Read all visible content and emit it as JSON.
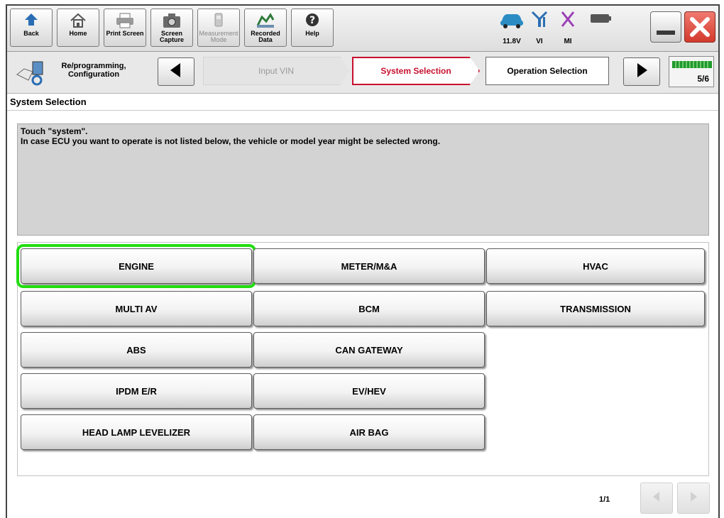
{
  "toolbar": {
    "back_label": "Back",
    "home_label": "Home",
    "print_screen_label": "Print Screen",
    "screen_capture_label": "Screen Capture",
    "measurement_mode_label": "Measurement Mode",
    "recorded_data_label": "Recorded Data",
    "help_label": "Help",
    "battery_voltage": "11.8V",
    "vi_label": "VI",
    "mi_label": "MI"
  },
  "navbar": {
    "module_label": "Re/programming, Configuration",
    "step_input_vin": "Input VIN",
    "step_system_selection": "System Selection",
    "step_operation_selection": "Operation Selection",
    "progress": "5/6"
  },
  "section_title": "System Selection",
  "message": {
    "line1": "Touch \"system\".",
    "line2": "In case ECU you want to operate is not listed below, the vehicle or model year might be selected wrong."
  },
  "systems": {
    "engine": "ENGINE",
    "meter": "METER/M&A",
    "hvac": "HVAC",
    "multi_av": "MULTI AV",
    "bcm": "BCM",
    "transmission": "TRANSMISSION",
    "abs": "ABS",
    "can_gateway": "CAN GATEWAY",
    "ipdm": "IPDM E/R",
    "ev_hev": "EV/HEV",
    "head_lamp": "HEAD LAMP LEVELIZER",
    "air_bag": "AIR BAG"
  },
  "pager": {
    "page": "1/1"
  },
  "colors": {
    "selected_outline": "#22dd11",
    "active_step_border": "#c8102e",
    "close_red": "#e8413a"
  }
}
